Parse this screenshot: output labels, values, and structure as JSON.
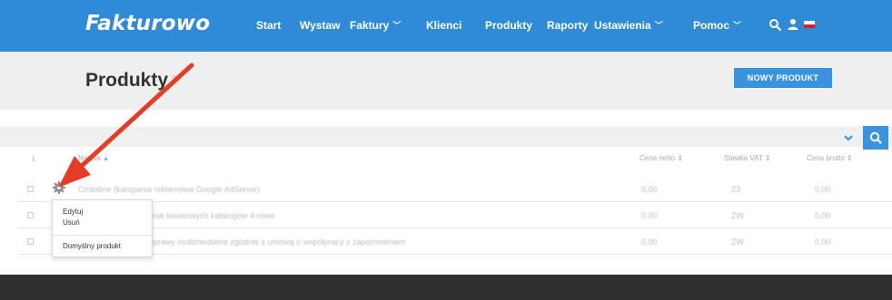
{
  "navbar": {
    "logo": "Fakturowo",
    "items": [
      {
        "label": "Start"
      },
      {
        "label": "Wystaw"
      },
      {
        "label": "Faktury"
      },
      {
        "label": "Klienci"
      },
      {
        "label": "Produkty"
      },
      {
        "label": "Raporty"
      },
      {
        "label": "Ustawienia"
      },
      {
        "label": "Pomoc"
      }
    ],
    "icons": [
      "search-icon",
      "user-icon",
      "flag-icon"
    ]
  },
  "header": {
    "title": "Produkty",
    "title_hint": "?",
    "new_button": "NOWY PRODUKT"
  },
  "table": {
    "columns": {
      "sort": "⇂",
      "name": "Nazwa ▲",
      "net": "Cena netto ⇕",
      "vat": "Stawka VAT ⇕",
      "gross": "Cena brutto ⇕"
    },
    "rows": [
      {
        "name": "Ozdobne (kampania reklamowa Google AdSense)",
        "net": "0,00",
        "vat": "23",
        "gross": "0,00"
      },
      {
        "name": "Druk kwiatowych katalogów 4-rowe",
        "net": "0,00",
        "vat": "ZW",
        "gross": "0,00"
      },
      {
        "name": "Oprawy multimedialne zgodnie z umową o współpracy z zapomnieniem",
        "net": "0,00",
        "vat": "ZW",
        "gross": "0,00"
      }
    ]
  },
  "menu": {
    "edit": "Edytuj",
    "delete": "Usuń",
    "default": "Domyślny produkt"
  },
  "colors": {
    "brand": "#2f8ad8",
    "arrow": "#e53c25",
    "footer": "#2f2f2f"
  }
}
